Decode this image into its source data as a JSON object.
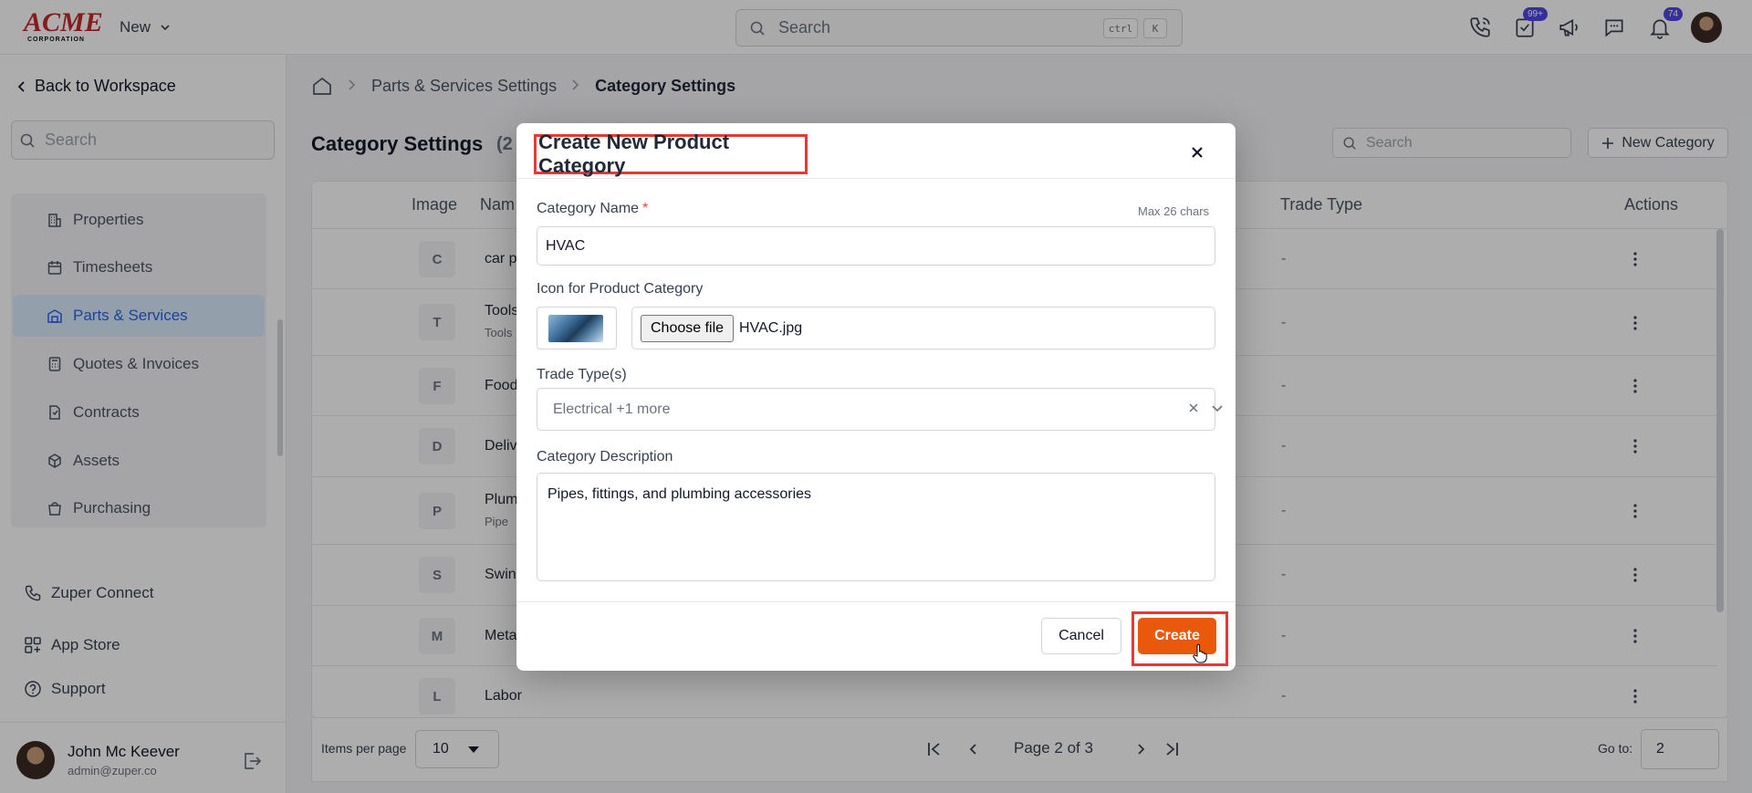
{
  "brand": {
    "logo_main": "ACME",
    "logo_sub": "CORPORATION"
  },
  "topbar": {
    "new_label": "New",
    "search_placeholder": "Search",
    "shortcut_keys": [
      "ctrl",
      "K"
    ],
    "badges": {
      "tasks": "99+",
      "notifications": "74"
    }
  },
  "sidebar": {
    "back_label": "Back to Workspace",
    "search_placeholder": "Search",
    "items": [
      {
        "label": "Properties",
        "icon": "building-icon"
      },
      {
        "label": "Timesheets",
        "icon": "calendar-icon"
      },
      {
        "label": "Parts & Services",
        "icon": "warehouse-icon",
        "active": true
      },
      {
        "label": "Quotes & Invoices",
        "icon": "calculator-icon"
      },
      {
        "label": "Contracts",
        "icon": "contract-icon"
      },
      {
        "label": "Assets",
        "icon": "cube-icon"
      },
      {
        "label": "Purchasing",
        "icon": "bag-icon"
      }
    ],
    "links": [
      {
        "label": "Zuper Connect",
        "icon": "phone-icon"
      },
      {
        "label": "App Store",
        "icon": "grid-icon"
      },
      {
        "label": "Support",
        "icon": "help-icon"
      }
    ],
    "user": {
      "name": "John Mc Keever",
      "email": "admin@zuper.co"
    }
  },
  "breadcrumb": {
    "level1": "Parts & Services Settings",
    "level2": "Category Settings"
  },
  "page": {
    "title": "Category Settings",
    "count": "(2",
    "search_placeholder": "Search",
    "new_category_label": "New Category"
  },
  "table": {
    "headers": {
      "image": "Image",
      "name": "Nam",
      "trade_type": "Trade Type",
      "actions": "Actions"
    },
    "rows": [
      {
        "initial": "C",
        "name": "car p",
        "sub": "",
        "trade": "-"
      },
      {
        "initial": "T",
        "name": "Tools",
        "sub": "Tools",
        "trade": "-"
      },
      {
        "initial": "F",
        "name": "Food",
        "sub": "",
        "trade": "-"
      },
      {
        "initial": "D",
        "name": "Deliv",
        "sub": "",
        "trade": "-"
      },
      {
        "initial": "P",
        "name": "Plum",
        "sub": "Pipe",
        "trade": "-"
      },
      {
        "initial": "S",
        "name": "Swin",
        "sub": "",
        "trade": "-"
      },
      {
        "initial": "M",
        "name": "Meta",
        "sub": "",
        "trade": "-"
      },
      {
        "initial": "L",
        "name": "Labor",
        "sub": "",
        "trade": "-"
      }
    ]
  },
  "pagination": {
    "items_per_page_label": "Items per page",
    "items_per_page": "10",
    "page_text": "Page 2 of 3",
    "goto_label": "Go to:",
    "goto_value": "2"
  },
  "modal": {
    "title": "Create New Product Category",
    "name_label": "Category Name",
    "required_mark": "*",
    "max_chars": "Max 26 chars",
    "name_value": "HVAC",
    "icon_label": "Icon for Product Category",
    "choose_file_label": "Choose file",
    "file_name": "HVAC.jpg",
    "trade_label": "Trade Type(s)",
    "trade_value": "Electrical +1 more",
    "desc_label": "Category Description",
    "desc_value": "Pipes, fittings, and plumbing accessories",
    "cancel_label": "Cancel",
    "create_label": "Create"
  },
  "colors": {
    "primary": "#ea580c",
    "highlight": "#e53935",
    "accent": "#2563eb",
    "badge": "#4f46e5"
  }
}
